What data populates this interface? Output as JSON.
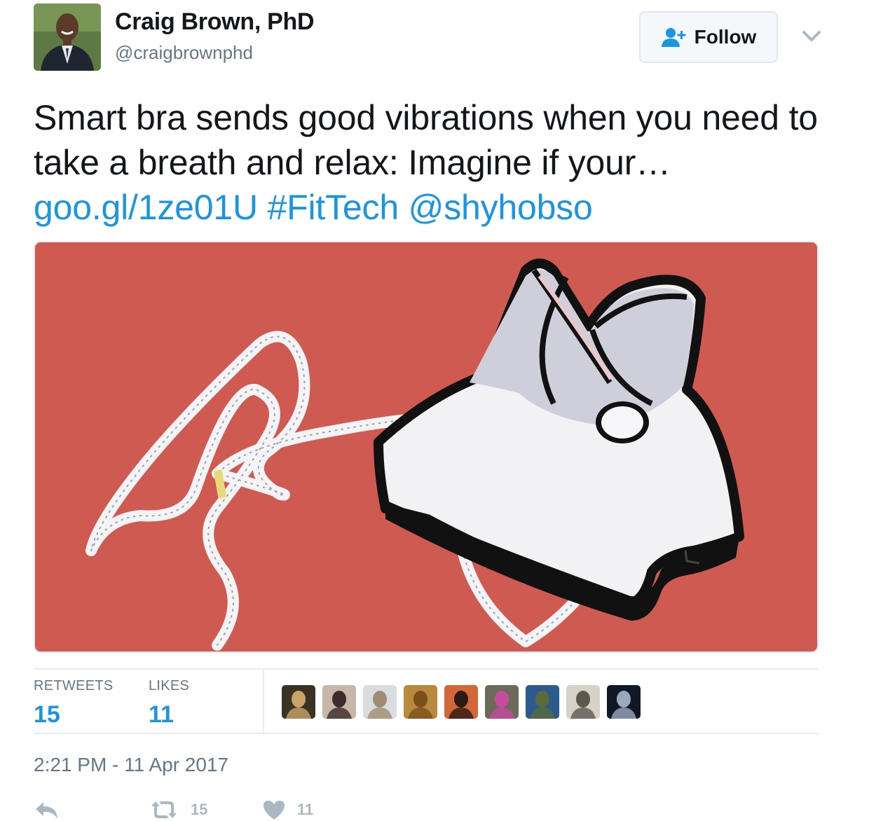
{
  "author": {
    "name": "Craig Brown, PhD",
    "handle": "@craigbrownphd"
  },
  "follow_button": {
    "label": "Follow"
  },
  "tweet": {
    "text": "Smart bra sends good vibrations when you need to take a breath and relax: Imagine if your… ",
    "link": "goo.gl/1ze01U",
    "hashtag": "#FitTech",
    "mention": "@shyhobso"
  },
  "stats": {
    "retweets_label": "RETWEETS",
    "retweets_value": "15",
    "likes_label": "LIKES",
    "likes_value": "11"
  },
  "timestamp": "2:21 PM - 11 Apr 2017",
  "actions": {
    "retweet_count": "15",
    "like_count": "11"
  },
  "liker_avatars": [
    {
      "bg": "#3a3324",
      "fg": "#c9a46a"
    },
    {
      "bg": "#c8b7a6",
      "fg": "#3b2b2a"
    },
    {
      "bg": "#d9dde0",
      "fg": "#a08c72"
    },
    {
      "bg": "#b98a3e",
      "fg": "#7a4f1a"
    },
    {
      "bg": "#d2673a",
      "fg": "#2b1a14"
    },
    {
      "bg": "#6e6a5a",
      "fg": "#c54aa0"
    },
    {
      "bg": "#2c5a8c",
      "fg": "#5a6b3a"
    },
    {
      "bg": "#d6d2c8",
      "fg": "#5c5850"
    },
    {
      "bg": "#101826",
      "fg": "#9aa8c0"
    }
  ],
  "colors": {
    "link_blue": "#1b95e0",
    "media_background": "#cf5a52",
    "secondary_text": "#657786",
    "action_icon": "#aab8c2"
  }
}
